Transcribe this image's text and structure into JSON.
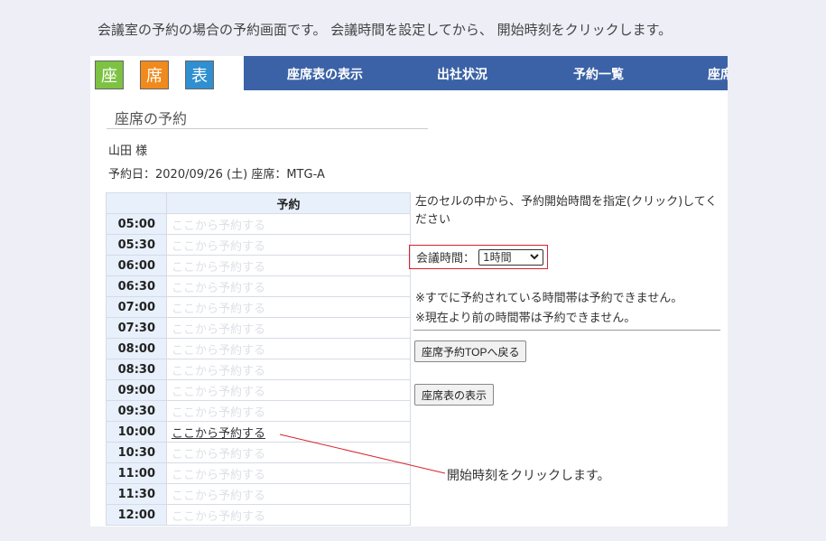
{
  "caption_top": "会議室の予約の場合の予約画面です。 会議時間を設定してから、 開始時刻をクリックします。",
  "logo": [
    {
      "char": "座",
      "color": "#7dc242"
    },
    {
      "char": "席",
      "color": "#f08a1c"
    },
    {
      "char": "表",
      "color": "#2f8fd0"
    }
  ],
  "nav": {
    "items": [
      "座席表の表示",
      "出社状況",
      "予約一覧",
      "座席"
    ]
  },
  "page_title": "座席の予約",
  "user_name": "山田 様",
  "reservation_info": "予約日：2020/09/26 (土) 座席：MTG-A",
  "table": {
    "header": "予約",
    "rows": [
      {
        "time": "05:00",
        "label": "ここから予約する",
        "active": false
      },
      {
        "time": "05:30",
        "label": "ここから予約する",
        "active": false
      },
      {
        "time": "06:00",
        "label": "ここから予約する",
        "active": false
      },
      {
        "time": "06:30",
        "label": "ここから予約する",
        "active": false
      },
      {
        "time": "07:00",
        "label": "ここから予約する",
        "active": false
      },
      {
        "time": "07:30",
        "label": "ここから予約する",
        "active": false
      },
      {
        "time": "08:00",
        "label": "ここから予約する",
        "active": false
      },
      {
        "time": "08:30",
        "label": "ここから予約する",
        "active": false
      },
      {
        "time": "09:00",
        "label": "ここから予約する",
        "active": false
      },
      {
        "time": "09:30",
        "label": "ここから予約する",
        "active": false
      },
      {
        "time": "10:00",
        "label": "ここから予約する",
        "active": true
      },
      {
        "time": "10:30",
        "label": "ここから予約する",
        "active": false
      },
      {
        "time": "11:00",
        "label": "ここから予約する",
        "active": false
      },
      {
        "time": "11:30",
        "label": "ここから予約する",
        "active": false
      },
      {
        "time": "12:00",
        "label": "ここから予約する",
        "active": false
      }
    ]
  },
  "instruction": "左のセルの中から、予約開始時間を指定(クリック)してください",
  "duration": {
    "label": "会議時間：",
    "selected": "1時間"
  },
  "notes": [
    "※すでに予約されている時間帯は予約できません。",
    "※現在より前の時間帯は予約できません。"
  ],
  "buttons": {
    "top": "座席予約TOPへ戻る",
    "chart": "座席表の表示"
  },
  "caption_callout": "開始時刻をクリックします。",
  "colors": {
    "nav_bg": "#3b62a6",
    "highlight_border": "#d9232d",
    "callout_line": "#d9232d"
  }
}
